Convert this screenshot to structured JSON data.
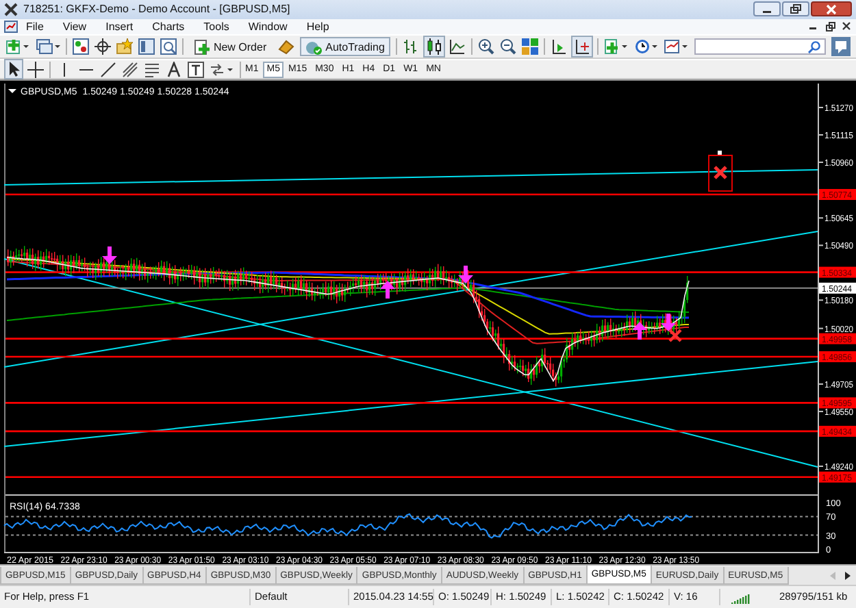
{
  "window": {
    "title": "718251: GKFX-Demo - Demo Account - [GBPUSD,M5]"
  },
  "menu": [
    "File",
    "View",
    "Insert",
    "Charts",
    "Tools",
    "Window",
    "Help"
  ],
  "toolbar": {
    "new_order": "New Order",
    "auto_trading": "AutoTrading"
  },
  "timeframes": [
    {
      "label": "M1",
      "selected": false
    },
    {
      "label": "M5",
      "selected": true
    },
    {
      "label": "M15",
      "selected": false
    },
    {
      "label": "M30",
      "selected": false
    },
    {
      "label": "H1",
      "selected": false
    },
    {
      "label": "H4",
      "selected": false
    },
    {
      "label": "D1",
      "selected": false
    },
    {
      "label": "W1",
      "selected": false
    },
    {
      "label": "MN",
      "selected": false
    }
  ],
  "chart": {
    "symbol": "GBPUSD,M5",
    "quotes": "1.50249 1.50249 1.50228 1.50244",
    "price_axis": [
      "1.51270",
      "1.51115",
      "1.50960",
      "1.50645",
      "1.50490",
      "1.50180",
      "1.50020",
      "1.49705",
      "1.49550",
      "1.49240"
    ],
    "levels": [
      "1.50774",
      "1.50334",
      "1.49958",
      "1.49856",
      "1.49595",
      "1.49434",
      "1.49175"
    ],
    "bid": "1.50244",
    "rsi": {
      "title": "RSI(14) 64.7338",
      "axis": [
        "100",
        "70",
        "30",
        "0"
      ]
    },
    "time_axis": [
      "22 Apr 2015",
      "22 Apr 23:10",
      "23 Apr 00:30",
      "23 Apr 01:50",
      "23 Apr 03:10",
      "23 Apr 04:30",
      "23 Apr 05:50",
      "23 Apr 07:10",
      "23 Apr 08:30",
      "23 Apr 09:50",
      "23 Apr 11:10",
      "23 Apr 12:30",
      "23 Apr 13:50"
    ]
  },
  "tabs": [
    {
      "label": "GBPUSD,M15",
      "selected": false
    },
    {
      "label": "GBPUSD,Daily",
      "selected": false
    },
    {
      "label": "GBPUSD,H4",
      "selected": false
    },
    {
      "label": "GBPUSD,M30",
      "selected": false
    },
    {
      "label": "GBPUSD,Weekly",
      "selected": false
    },
    {
      "label": "GBPUSD,Monthly",
      "selected": false
    },
    {
      "label": "AUDUSD,Weekly",
      "selected": false
    },
    {
      "label": "GBPUSD,H1",
      "selected": false
    },
    {
      "label": "GBPUSD,M5",
      "selected": true
    },
    {
      "label": "EURUSD,Daily",
      "selected": false
    },
    {
      "label": "EURUSD,M5",
      "selected": false
    }
  ],
  "status_bar": [
    "For Help, press F1",
    "Default",
    "2015.04.23 14:55",
    "O: 1.50249",
    "H: 1.50249",
    "L: 1.50242",
    "C: 1.50242",
    "V: 16",
    "289795/151 kb"
  ]
}
